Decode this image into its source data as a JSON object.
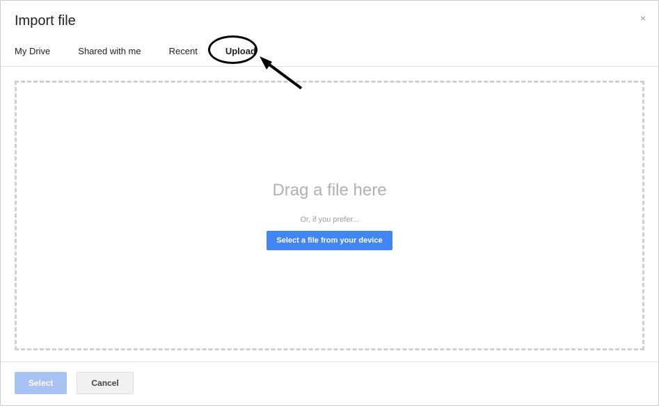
{
  "dialog": {
    "title": "Import file",
    "close_glyph": "×"
  },
  "tabs": [
    {
      "label": "My Drive"
    },
    {
      "label": "Shared with me"
    },
    {
      "label": "Recent"
    },
    {
      "label": "Upload"
    }
  ],
  "dropzone": {
    "drag_text": "Drag a file here",
    "prefer_text": "Or, if you prefer...",
    "select_button": "Select a file from your device"
  },
  "footer": {
    "select_label": "Select",
    "cancel_label": "Cancel"
  }
}
